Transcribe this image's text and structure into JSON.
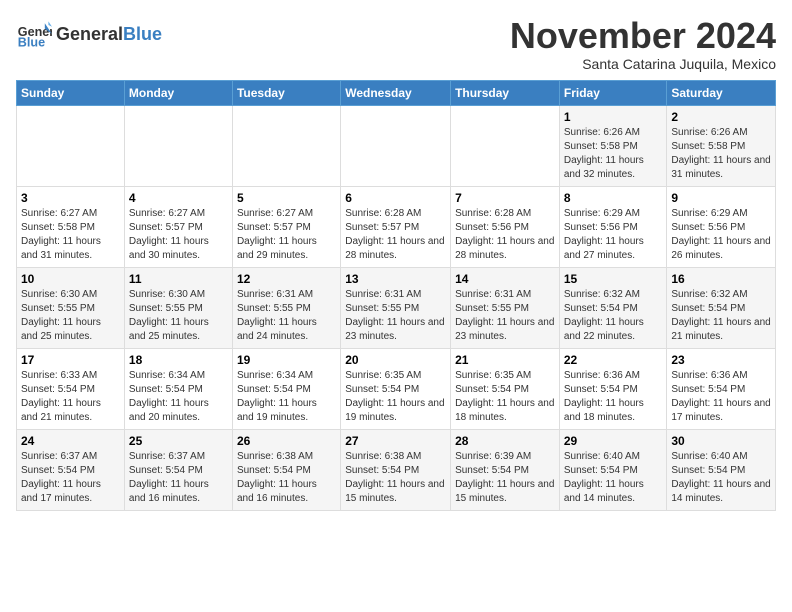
{
  "logo": {
    "general": "General",
    "blue": "Blue"
  },
  "header": {
    "month": "November 2024",
    "location": "Santa Catarina Juquila, Mexico"
  },
  "weekdays": [
    "Sunday",
    "Monday",
    "Tuesday",
    "Wednesday",
    "Thursday",
    "Friday",
    "Saturday"
  ],
  "weeks": [
    [
      {
        "day": "",
        "info": ""
      },
      {
        "day": "",
        "info": ""
      },
      {
        "day": "",
        "info": ""
      },
      {
        "day": "",
        "info": ""
      },
      {
        "day": "",
        "info": ""
      },
      {
        "day": "1",
        "info": "Sunrise: 6:26 AM\nSunset: 5:58 PM\nDaylight: 11 hours and 32 minutes."
      },
      {
        "day": "2",
        "info": "Sunrise: 6:26 AM\nSunset: 5:58 PM\nDaylight: 11 hours and 31 minutes."
      }
    ],
    [
      {
        "day": "3",
        "info": "Sunrise: 6:27 AM\nSunset: 5:58 PM\nDaylight: 11 hours and 31 minutes."
      },
      {
        "day": "4",
        "info": "Sunrise: 6:27 AM\nSunset: 5:57 PM\nDaylight: 11 hours and 30 minutes."
      },
      {
        "day": "5",
        "info": "Sunrise: 6:27 AM\nSunset: 5:57 PM\nDaylight: 11 hours and 29 minutes."
      },
      {
        "day": "6",
        "info": "Sunrise: 6:28 AM\nSunset: 5:57 PM\nDaylight: 11 hours and 28 minutes."
      },
      {
        "day": "7",
        "info": "Sunrise: 6:28 AM\nSunset: 5:56 PM\nDaylight: 11 hours and 28 minutes."
      },
      {
        "day": "8",
        "info": "Sunrise: 6:29 AM\nSunset: 5:56 PM\nDaylight: 11 hours and 27 minutes."
      },
      {
        "day": "9",
        "info": "Sunrise: 6:29 AM\nSunset: 5:56 PM\nDaylight: 11 hours and 26 minutes."
      }
    ],
    [
      {
        "day": "10",
        "info": "Sunrise: 6:30 AM\nSunset: 5:55 PM\nDaylight: 11 hours and 25 minutes."
      },
      {
        "day": "11",
        "info": "Sunrise: 6:30 AM\nSunset: 5:55 PM\nDaylight: 11 hours and 25 minutes."
      },
      {
        "day": "12",
        "info": "Sunrise: 6:31 AM\nSunset: 5:55 PM\nDaylight: 11 hours and 24 minutes."
      },
      {
        "day": "13",
        "info": "Sunrise: 6:31 AM\nSunset: 5:55 PM\nDaylight: 11 hours and 23 minutes."
      },
      {
        "day": "14",
        "info": "Sunrise: 6:31 AM\nSunset: 5:55 PM\nDaylight: 11 hours and 23 minutes."
      },
      {
        "day": "15",
        "info": "Sunrise: 6:32 AM\nSunset: 5:54 PM\nDaylight: 11 hours and 22 minutes."
      },
      {
        "day": "16",
        "info": "Sunrise: 6:32 AM\nSunset: 5:54 PM\nDaylight: 11 hours and 21 minutes."
      }
    ],
    [
      {
        "day": "17",
        "info": "Sunrise: 6:33 AM\nSunset: 5:54 PM\nDaylight: 11 hours and 21 minutes."
      },
      {
        "day": "18",
        "info": "Sunrise: 6:34 AM\nSunset: 5:54 PM\nDaylight: 11 hours and 20 minutes."
      },
      {
        "day": "19",
        "info": "Sunrise: 6:34 AM\nSunset: 5:54 PM\nDaylight: 11 hours and 19 minutes."
      },
      {
        "day": "20",
        "info": "Sunrise: 6:35 AM\nSunset: 5:54 PM\nDaylight: 11 hours and 19 minutes."
      },
      {
        "day": "21",
        "info": "Sunrise: 6:35 AM\nSunset: 5:54 PM\nDaylight: 11 hours and 18 minutes."
      },
      {
        "day": "22",
        "info": "Sunrise: 6:36 AM\nSunset: 5:54 PM\nDaylight: 11 hours and 18 minutes."
      },
      {
        "day": "23",
        "info": "Sunrise: 6:36 AM\nSunset: 5:54 PM\nDaylight: 11 hours and 17 minutes."
      }
    ],
    [
      {
        "day": "24",
        "info": "Sunrise: 6:37 AM\nSunset: 5:54 PM\nDaylight: 11 hours and 17 minutes."
      },
      {
        "day": "25",
        "info": "Sunrise: 6:37 AM\nSunset: 5:54 PM\nDaylight: 11 hours and 16 minutes."
      },
      {
        "day": "26",
        "info": "Sunrise: 6:38 AM\nSunset: 5:54 PM\nDaylight: 11 hours and 16 minutes."
      },
      {
        "day": "27",
        "info": "Sunrise: 6:38 AM\nSunset: 5:54 PM\nDaylight: 11 hours and 15 minutes."
      },
      {
        "day": "28",
        "info": "Sunrise: 6:39 AM\nSunset: 5:54 PM\nDaylight: 11 hours and 15 minutes."
      },
      {
        "day": "29",
        "info": "Sunrise: 6:40 AM\nSunset: 5:54 PM\nDaylight: 11 hours and 14 minutes."
      },
      {
        "day": "30",
        "info": "Sunrise: 6:40 AM\nSunset: 5:54 PM\nDaylight: 11 hours and 14 minutes."
      }
    ]
  ]
}
